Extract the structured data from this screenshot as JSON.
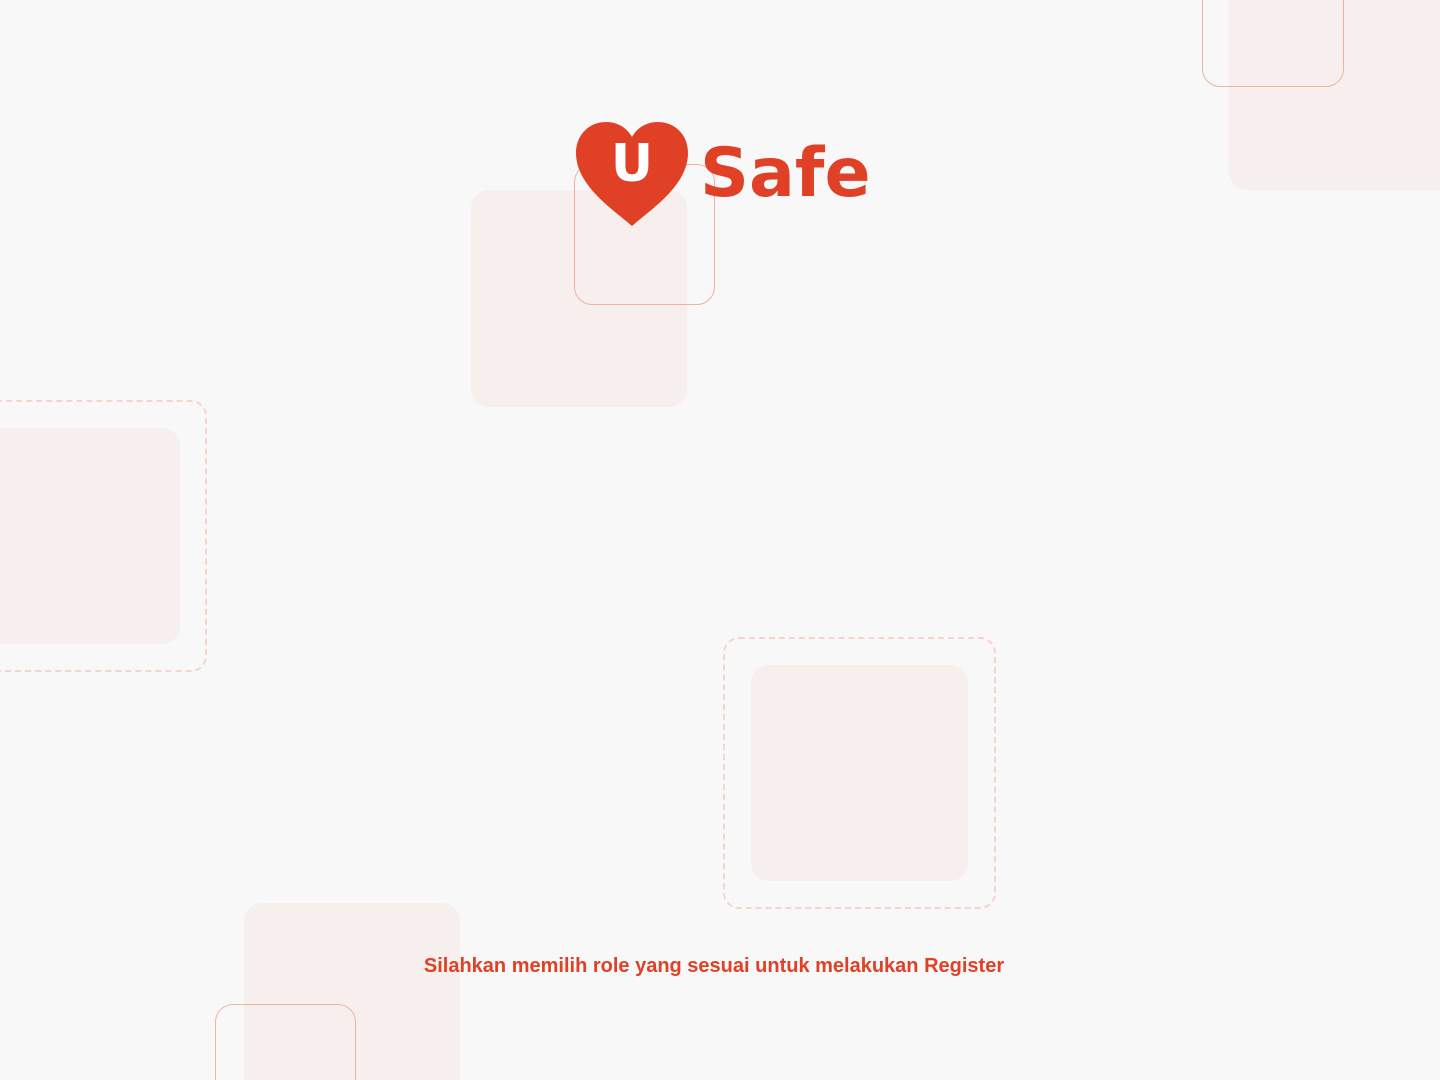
{
  "brand": {
    "logo_letter": "U",
    "logo_word": "Safe",
    "color": "#e04026",
    "icon": "heart-icon"
  },
  "main": {
    "instruction": "Silahkan memilih role yang sesuai untuk melakukan Register"
  },
  "colors": {
    "background": "#f8f8f8",
    "decor_fill": "#f6efed",
    "decor_outline": "#f0b3a3",
    "decor_dashed": "#f6d3cc"
  }
}
